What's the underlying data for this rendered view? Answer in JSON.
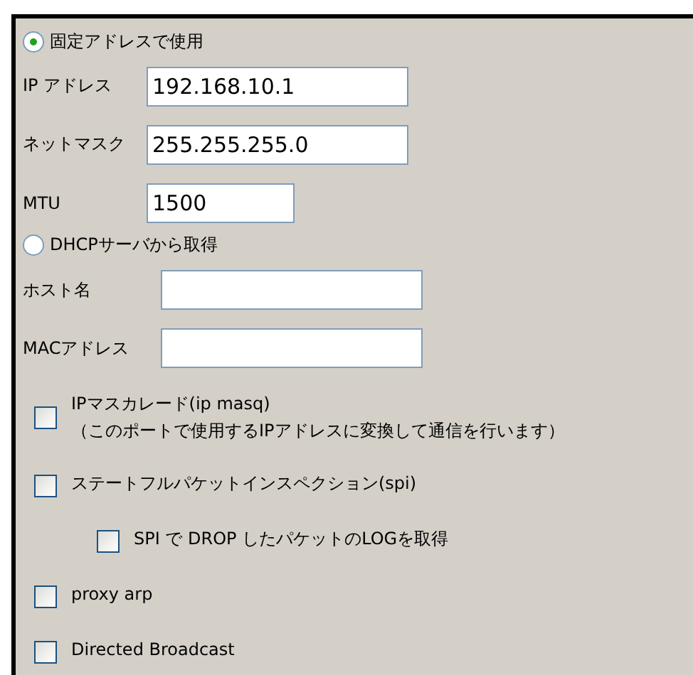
{
  "address_modes": [
    {
      "label": "固定アドレスで使用",
      "selected": true,
      "fields": [
        {
          "label": "IP アドレス",
          "value": "192.168.10.1",
          "kind": "wide"
        },
        {
          "label": "ネットマスク",
          "value": "255.255.255.0",
          "kind": "wide"
        },
        {
          "label": "MTU",
          "value": "1500",
          "kind": "short"
        }
      ]
    },
    {
      "label": "DHCPサーバから取得",
      "selected": false,
      "fields": [
        {
          "label": "ホスト名",
          "kind": "wide"
        },
        {
          "label": "MACアドレス",
          "kind": "wide"
        }
      ]
    }
  ],
  "options": [
    {
      "lines": [
        "IPマスカレード(ip masq)",
        "（このポートで使用するIPアドレスに変換して通信を行います）"
      ],
      "checked": false
    },
    {
      "lines": [
        "ステートフルパケットインスペクション(spi)"
      ],
      "checked": false,
      "children": [
        {
          "lines": [
            "SPI で DROP したパケットのLOGを取得"
          ],
          "checked": false
        }
      ]
    },
    {
      "lines": [
        "proxy arp"
      ],
      "checked": false
    },
    {
      "lines": [
        "Directed Broadcast"
      ],
      "checked": false
    }
  ]
}
